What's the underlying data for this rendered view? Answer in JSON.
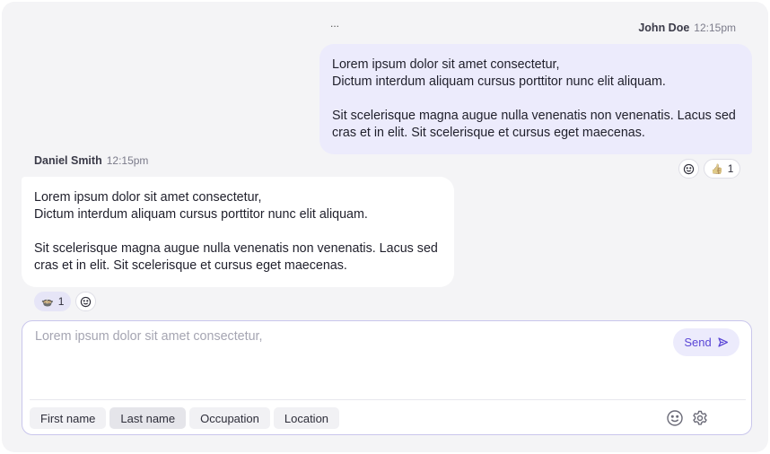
{
  "messages": [
    {
      "author": "John Doe",
      "time": "12:15pm",
      "more_label": "...",
      "paragraph1": "Lorem ipsum dolor sit amet consectetur,\nDictum interdum aliquam cursus porttitor nunc elit aliquam.",
      "paragraph2": "Sit scelerisque magna augue nulla venenatis non venenatis. Lacus sed cras et in elit. Sit scelerisque et cursus eget maecenas.",
      "reaction": {
        "icon": "thumbs-up-icon",
        "glyph": "👍",
        "count": "1"
      }
    },
    {
      "author": "Daniel Smith",
      "time": "12:15pm",
      "paragraph1": "Lorem ipsum dolor sit amet consectetur,\nDictum interdum aliquam cursus porttitor nunc elit aliquam.",
      "paragraph2": "Sit scelerisque magna augue nulla venenatis non venenatis. Lacus sed cras et in elit. Sit scelerisque et cursus eget maecenas.",
      "reaction": {
        "icon": "bowl-icon",
        "glyph": "🍲",
        "count": "1"
      }
    }
  ],
  "composer": {
    "placeholder": "Lorem ipsum dolor sit amet consectetur,",
    "send_label": "Send",
    "chips": [
      "First name",
      "Last name",
      "Occupation",
      "Location"
    ],
    "active_chip": "Last name"
  },
  "colors": {
    "accent": "#5a46d6",
    "outgoing_bubble": "#ecebfc",
    "incoming_bubble": "#ffffff",
    "background": "#f4f4f6"
  }
}
